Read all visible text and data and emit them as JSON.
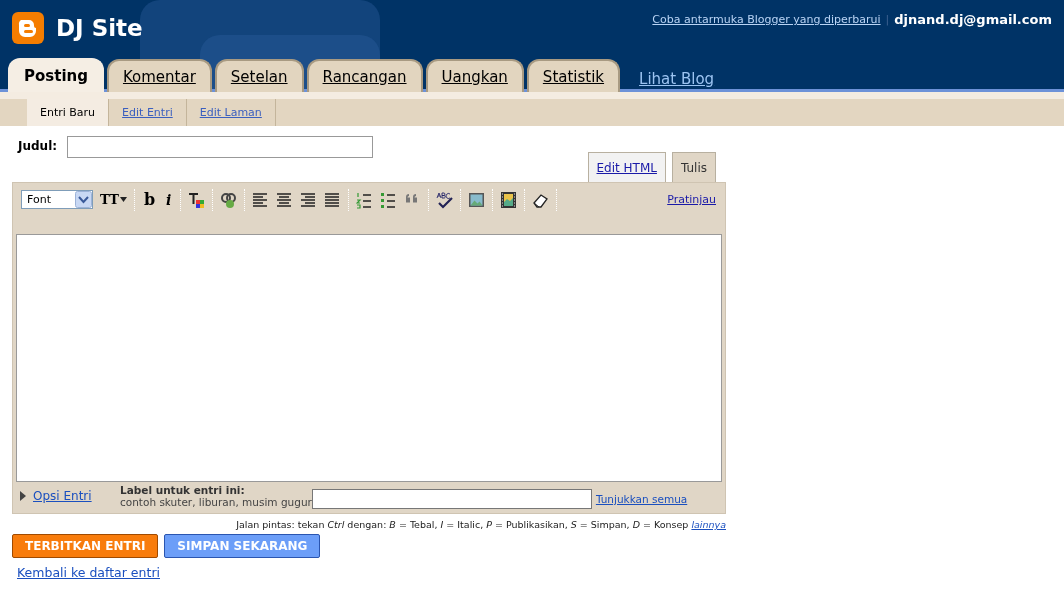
{
  "header": {
    "site_title": "DJ Site",
    "top_link": "Coba antarmuka Blogger yang diperbarui",
    "separator": "|",
    "account": "djnand.dj@gmail.com"
  },
  "tabs": [
    {
      "label": "Posting",
      "selected": true
    },
    {
      "label": "Komentar",
      "selected": false
    },
    {
      "label": "Setelan",
      "selected": false
    },
    {
      "label": "Rancangan",
      "selected": false
    },
    {
      "label": "Uangkan",
      "selected": false
    },
    {
      "label": "Statistik",
      "selected": false
    }
  ],
  "view_blog_link": "Lihat Blog",
  "subtabs": [
    {
      "label": "Entri Baru",
      "selected": true
    },
    {
      "label": "Edit Entri",
      "selected": false
    },
    {
      "label": "Edit Laman",
      "selected": false
    }
  ],
  "title_field": {
    "label": "Judul:"
  },
  "editor_modes": [
    {
      "label": "Edit HTML",
      "selected": false
    },
    {
      "label": "Tulis",
      "selected": true
    }
  ],
  "toolbar": {
    "groups": [
      [
        {
          "kind": "select",
          "label": "Font"
        },
        {
          "kind": "text-size",
          "label": "TT"
        }
      ],
      [
        {
          "kind": "bold",
          "label": "b"
        },
        {
          "kind": "italic",
          "label": "i"
        }
      ],
      [
        {
          "kind": "text-color"
        }
      ],
      [
        {
          "kind": "link"
        }
      ],
      [
        {
          "kind": "align-left"
        },
        {
          "kind": "align-center"
        },
        {
          "kind": "align-right"
        },
        {
          "kind": "justify"
        }
      ],
      [
        {
          "kind": "numbered-list"
        },
        {
          "kind": "bullet-list"
        },
        {
          "kind": "quote"
        }
      ],
      [
        {
          "kind": "spellcheck"
        }
      ],
      [
        {
          "kind": "image"
        }
      ],
      [
        {
          "kind": "video"
        }
      ],
      [
        {
          "kind": "eraser"
        }
      ]
    ],
    "preview_link": "Pratinjau"
  },
  "post_options": {
    "toggle": "Opsi Entri",
    "expanded": false,
    "labels_title": "Label untuk entri ini:",
    "labels_example": "contoh skuter, liburan, musim gugur",
    "show_all": "Tunjukkan semua"
  },
  "shortcut_hint": {
    "text": "Jalan pintas: tekan *Ctrl* dengan: *B* = Tebal, *I* = Italic, *P* = Publikasikan, *S* = Simpan, *D* = Konsep",
    "link": "lainnya"
  },
  "buttons": [
    {
      "label": "TERBITKAN ENTRI",
      "kind": "publish"
    },
    {
      "label": "SIMPAN SEKARANG",
      "kind": "save"
    }
  ],
  "back_link": "Kembali ke daftar entri"
}
